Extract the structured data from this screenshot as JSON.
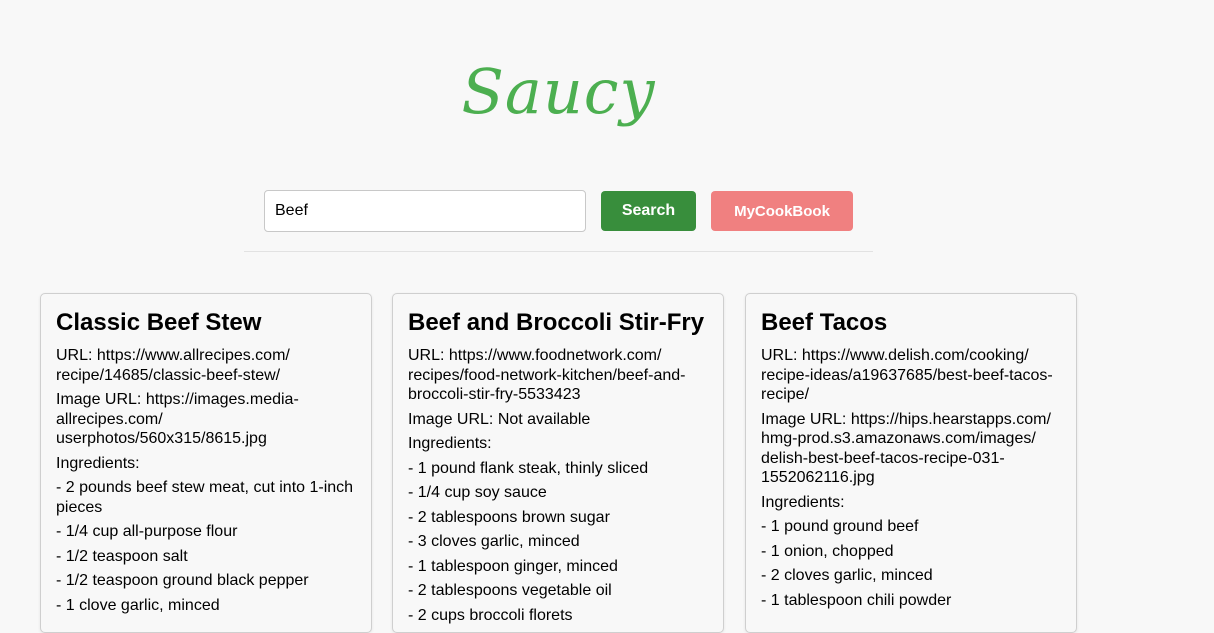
{
  "app": {
    "logo": "Saucy"
  },
  "search": {
    "value": "Beef",
    "button_label": "Search"
  },
  "cookbook_button_label": "MyCookBook",
  "recipes": [
    {
      "title": "Classic Beef Stew",
      "url_line": "URL: https://www.allrecipes.com/ recipe/14685/classic-beef-stew/",
      "image_line": "Image URL: https://images.media-allrecipes.com/ userphotos/560x315/8615.jpg",
      "ingredients_label": "Ingredients:",
      "ingredients": [
        "- 2 pounds beef stew meat, cut into 1-inch pieces",
        "- 1/4 cup all-purpose flour",
        "- 1/2 teaspoon salt",
        "- 1/2 teaspoon ground black pepper",
        "- 1 clove garlic, minced"
      ]
    },
    {
      "title": "Beef and Broccoli Stir-Fry",
      "url_line": "URL: https://www.foodnetwork.com/ recipes/food-network-kitchen/beef-and-broccoli-stir-fry-5533423",
      "image_line": "Image URL: Not available",
      "ingredients_label": "Ingredients:",
      "ingredients": [
        "- 1 pound flank steak, thinly sliced",
        "- 1/4 cup soy sauce",
        "- 2 tablespoons brown sugar",
        "- 3 cloves garlic, minced",
        "- 1 tablespoon ginger, minced",
        "- 2 tablespoons vegetable oil",
        "- 2 cups broccoli florets"
      ]
    },
    {
      "title": "Beef Tacos",
      "url_line": "URL: https://www.delish.com/cooking/ recipe-ideas/a19637685/best-beef-tacos-recipe/",
      "image_line": "Image URL: https://hips.hearstapps.com/ hmg-prod.s3.amazonaws.com/images/ delish-best-beef-tacos-recipe-031-1552062116.jpg",
      "ingredients_label": "Ingredients:",
      "ingredients": [
        "- 1 pound ground beef",
        "- 1 onion, chopped",
        "- 2 cloves garlic, minced",
        "- 1 tablespoon chili powder"
      ]
    }
  ]
}
